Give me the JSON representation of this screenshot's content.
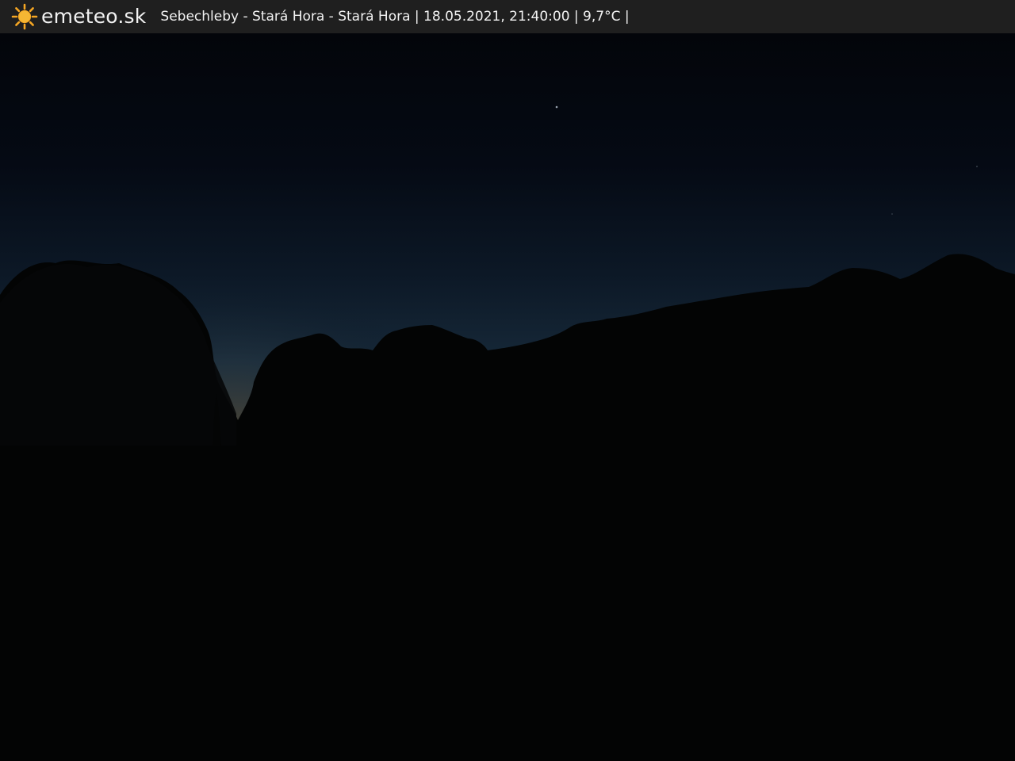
{
  "header": {
    "brand": "emeteo.sk",
    "caption": "Sebechleby - Stará Hora - Stará Hora | 18.05.2021, 21:40:00 | 9,7°C |",
    "logo_icon": "sun-icon",
    "sun_color": "#f5a623"
  },
  "scene": {
    "description_icon": "night-landscape-photo",
    "sky_top_color": "#03050a",
    "sky_horizon_color": "#1a2c3c",
    "glow_color": "#5a4a32",
    "ground_color": "#030303"
  }
}
